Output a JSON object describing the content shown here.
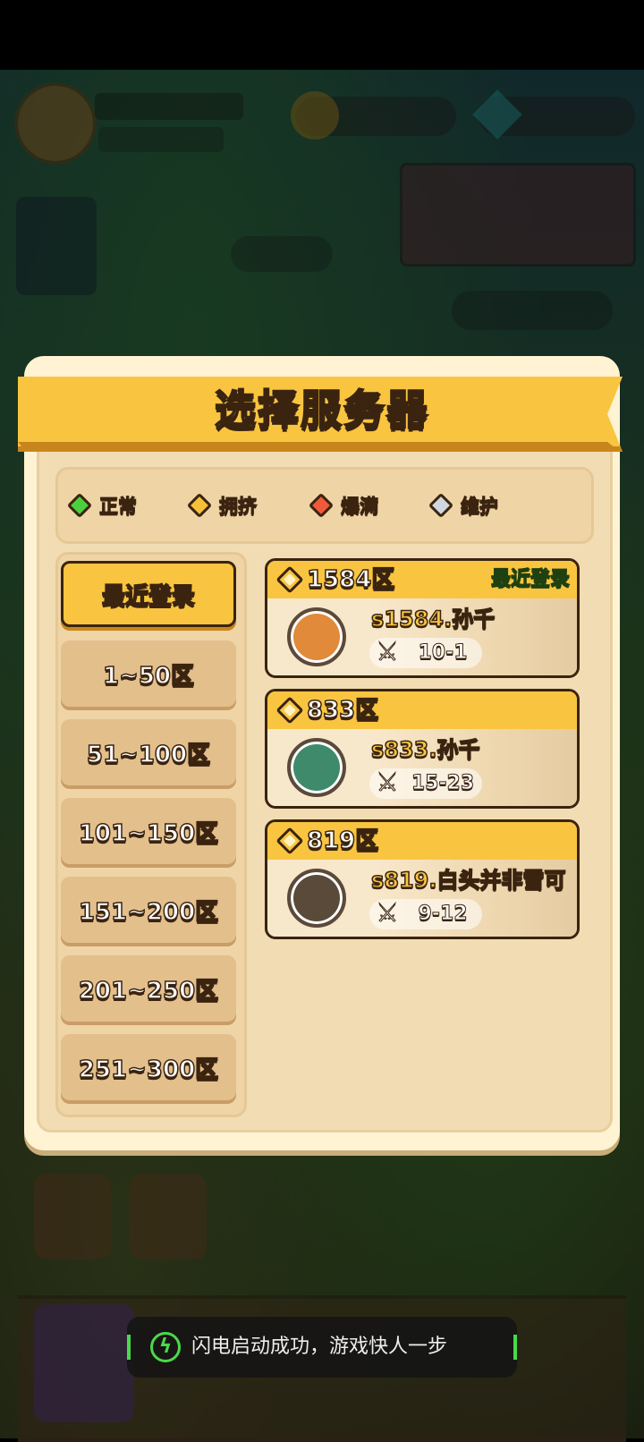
{
  "dialog": {
    "title": "选择服务器"
  },
  "legend": [
    {
      "label": "正常",
      "color": "#4ccf3e"
    },
    {
      "label": "拥挤",
      "color": "#f7c03a"
    },
    {
      "label": "爆满",
      "color": "#f05a3a"
    },
    {
      "label": "维护",
      "color": "#cfd8e0"
    }
  ],
  "ranges": [
    {
      "label": "最近登录",
      "active": true
    },
    {
      "label": "1~50区",
      "active": false
    },
    {
      "label": "51~100区",
      "active": false
    },
    {
      "label": "101~150区",
      "active": false
    },
    {
      "label": "151~200区",
      "active": false
    },
    {
      "label": "201~250区",
      "active": false
    },
    {
      "label": "251~300区",
      "active": false
    }
  ],
  "servers": [
    {
      "zone": "1584区",
      "recent_tag": "最近登录",
      "name": "s1584.孙千",
      "stage": "10-1",
      "avatar_color": "#e08a3a"
    },
    {
      "zone": "833区",
      "recent_tag": "",
      "name": "s833.孙千",
      "stage": "15-23",
      "avatar_color": "#3f8a6a"
    },
    {
      "zone": "819区",
      "recent_tag": "",
      "name": "s819.白头并非雪可",
      "stage": "9-12",
      "avatar_color": "#5a4a3a"
    }
  ],
  "toast": {
    "text": "闪电启动成功，游戏快人一步",
    "icon": "lightning-icon"
  }
}
